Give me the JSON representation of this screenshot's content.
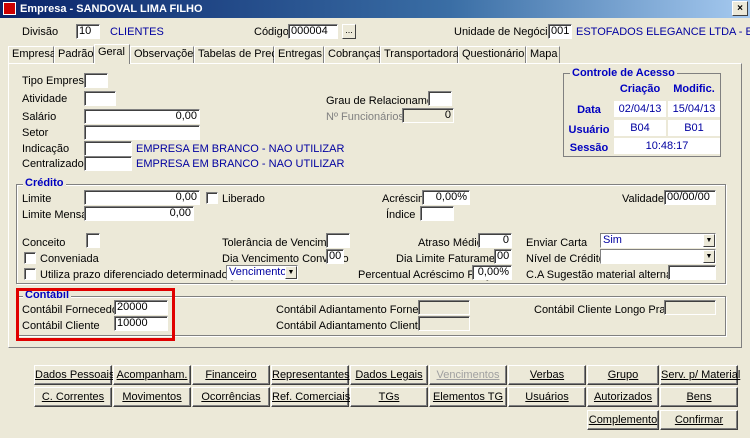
{
  "window": {
    "title": "Empresa - SANDOVAL LIMA FILHO"
  },
  "header": {
    "divisao_label": "Divisão",
    "divisao_value": "10",
    "divisao_name": "CLIENTES",
    "codigo_label": "Código",
    "codigo_value": "000004",
    "lookup_btn": "...",
    "unidade_label": "Unidade de Negócio",
    "unidade_value": "001",
    "unidade_name": "ESTOFADOS ELEGANCE LTDA - EPP"
  },
  "tabs": [
    "Empresa",
    "Padrão",
    "Geral",
    "Observações",
    "Tabelas de Preço",
    "Entregas",
    "Cobranças",
    "Transportadoras",
    "Questionário",
    "Mapa"
  ],
  "active_tab": "Geral",
  "geral": {
    "tipo_empresa": "Tipo Empresa",
    "atividade": "Atividade",
    "salario": "Salário",
    "salario_value": "0,00",
    "setor": "Setor",
    "indicacao": "Indicação",
    "indicacao_desc": "EMPRESA EM BRANCO - NAO UTILIZAR",
    "centralizadora": "Centralizadora",
    "centralizadora_desc": "EMPRESA EM BRANCO - NAO UTILIZAR",
    "grau": "Grau de Relacionamento",
    "num_func": "Nº Funcionários",
    "num_func_value": "0"
  },
  "controle": {
    "title": "Controle de Acesso",
    "col_criacao": "Criação",
    "col_modif": "Modific.",
    "row_data": "Data",
    "data_criacao": "02/04/13",
    "data_modif": "15/04/13",
    "row_usuario": "Usuário",
    "usuario_criacao": "B04",
    "usuario_modif": "B01",
    "row_sessao": "Sessão",
    "sessao_value": "10:48:17"
  },
  "credito": {
    "title": "Crédito",
    "limite": "Limite",
    "limite_value": "0,00",
    "liberado": "Liberado",
    "acrescimo": "Acréscimo",
    "acrescimo_value": "0,00%",
    "validade": "Validade",
    "validade_value": "00/00/00",
    "limite_mensal": "Limite Mensal",
    "limite_mensal_value": "0,00",
    "indice": "Índice",
    "conceito": "Conceito",
    "tolerancia": "Tolerância de Vencimento",
    "atraso": "Atraso Médio",
    "atraso_value": "0",
    "enviar_carta": "Enviar Carta",
    "enviar_carta_value": "Sim",
    "conveniada": "Conveniada",
    "dia_venc": "Dia Vencimento Convênio",
    "dia_venc_value": "00",
    "dia_limite": "Dia Limite Faturamento",
    "dia_limite_value": "00",
    "nivel": "Nível de Crédito",
    "utiliza_prazo": "Utiliza prazo diferenciado determinado por",
    "prazo_value": "Vencimento",
    "percentual": "Percentual Acréscimo Preço",
    "percentual_value": "0,00%",
    "ca_sugestao": "C.A Sugestão material alternativo"
  },
  "contabil": {
    "title": "Contábil",
    "fornecedor": "Contábil Fornecedor",
    "fornecedor_value": "20000",
    "cliente": "Contábil Cliente",
    "cliente_value": "10000",
    "adiant_fornecedor": "Contábil Adiantamento Fornecedor",
    "adiant_cliente": "Contábil Adiantamento Cliente",
    "cliente_longo": "Contábil Cliente Longo Prazo"
  },
  "buttons_row1": [
    "Dados Pessoais",
    "Acompanham.",
    "Financeiro",
    "Representantes",
    "Dados Legais",
    "Vencimentos",
    "Verbas",
    "Grupo",
    "Serv. p/ Material"
  ],
  "buttons_row2": [
    "C. Correntes",
    "Movimentos",
    "Ocorrências",
    "Ref. Comerciais",
    "TGs",
    "Elementos TG",
    "Usuários",
    "Autorizados",
    "Bens"
  ],
  "buttons_row3": [
    "Complemento",
    "Confirmar"
  ]
}
